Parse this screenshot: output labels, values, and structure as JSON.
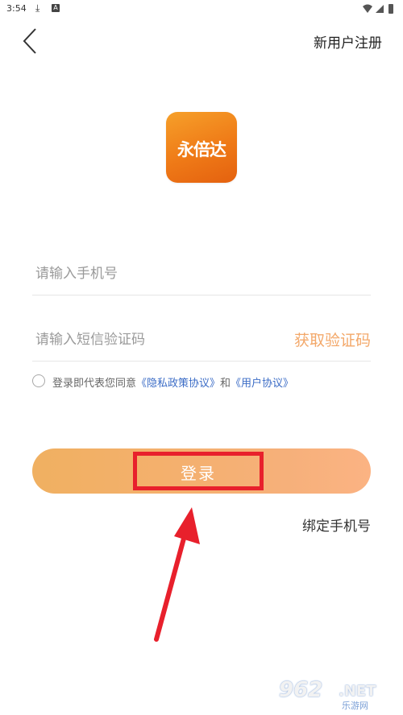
{
  "status_bar": {
    "time": "3:54",
    "download_icon": "download-arrow-icon",
    "notification_badge": "A"
  },
  "header": {
    "back_icon": "chevron-left-icon",
    "register_label": "新用户注册"
  },
  "logo": {
    "text": "永倍达",
    "color_start": "#f6a02a",
    "color_end": "#e4610f"
  },
  "form": {
    "phone_placeholder": "请输入手机号",
    "phone_value": "",
    "code_placeholder": "请输入短信验证码",
    "code_value": "",
    "get_code_label": "获取验证码"
  },
  "agreement": {
    "prefix": "登录即代表您同意",
    "privacy_link": "《隐私政策协议》",
    "and": "和",
    "user_link": "《用户协议》",
    "checked": false
  },
  "login_button": {
    "label": "登录",
    "gradient_start": "#f0b061",
    "gradient_end": "#fbb383"
  },
  "bind_phone_label": "绑定手机号",
  "annotation": {
    "highlight_color": "#e8202c"
  },
  "watermark": {
    "brand_number": "962",
    "brand_suffix": ".NET",
    "sub_text": "乐游网"
  },
  "colors": {
    "accent_orange": "#f3a86a",
    "link_blue": "#3b6cc6"
  }
}
